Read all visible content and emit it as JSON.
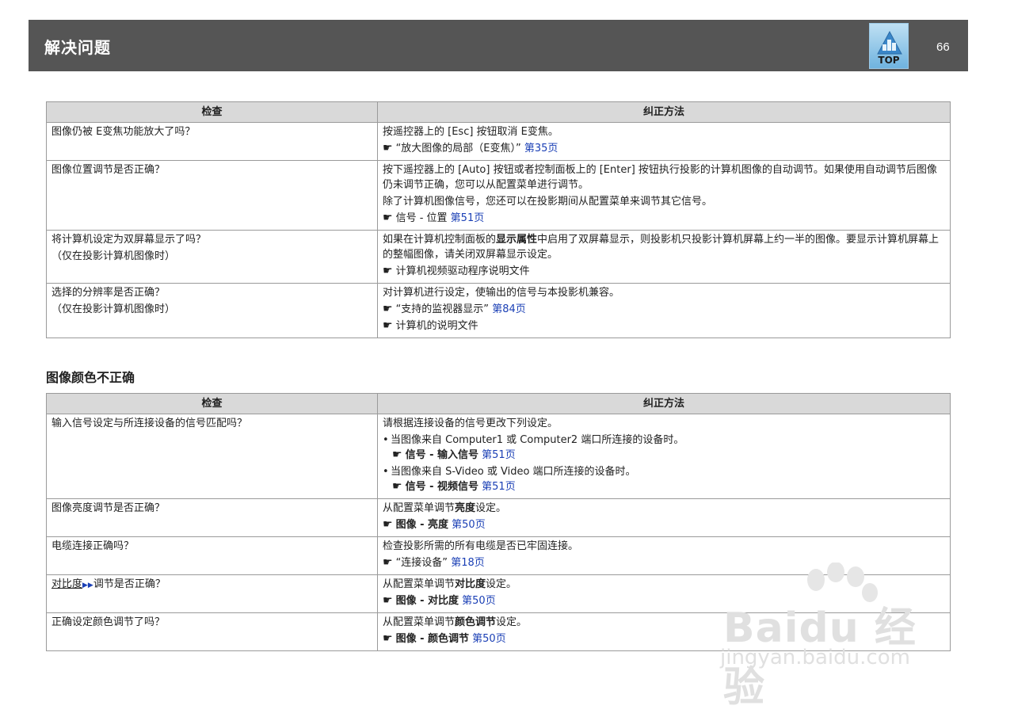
{
  "header": {
    "title": "解决问题",
    "top_label": "TOP",
    "page_number": "66"
  },
  "table1": {
    "col_check": "检查",
    "col_fix": "纠正方法",
    "rows": [
      {
        "check": [
          "图像仍被 E变焦功能放大了吗？"
        ],
        "fix": {
          "l1": "按遥控器上的 [Esc] 按钮取消 E变焦。",
          "ref_text": "“放大图像的局部（E变焦）”",
          "ref_page": "第35页"
        }
      },
      {
        "check": [
          "图像位置调节是否正确？"
        ],
        "fix": {
          "l1": "按下遥控器上的 [Auto] 按钮或者控制面板上的 [Enter] 按钮执行投影的计算机图像的自动调节。如果使用自动调节后图像仍未调节正确，您可以从配置菜单进行调节。",
          "l2": "除了计算机图像信号，您还可以在投影期间从配置菜单来调节其它信号。",
          "ref_text": "信号 - 位置",
          "ref_page": "第51页"
        }
      },
      {
        "check": [
          "将计算机设定为双屏幕显示了吗？",
          "（仅在投影计算机图像时）"
        ],
        "fix": {
          "l1a": "如果在计算机控制面板的",
          "l1b": "显示属性",
          "l1c": "中启用了双屏幕显示，则投影机只投影计算机屏幕上约一半的图像。要显示计算机屏幕上的整幅图像，请关闭双屏幕显示设定。",
          "ref_text": "计算机视频驱动程序说明文件"
        }
      },
      {
        "check": [
          "选择的分辨率是否正确？",
          "（仅在投影计算机图像时）"
        ],
        "fix": {
          "l1": "对计算机进行设定，使输出的信号与本投影机兼容。",
          "ref_text": "“支持的监视器显示”",
          "ref_page": "第84页",
          "ref2_text": "计算机的说明文件"
        }
      }
    ]
  },
  "section2": {
    "title": "图像颜色不正确"
  },
  "table2": {
    "col_check": "检查",
    "col_fix": "纠正方法",
    "rows": [
      {
        "check": "输入信号设定与所连接设备的信号匹配吗？",
        "fix": {
          "l1": "请根据连接设备的信号更改下列设定。",
          "b1": "当图像来自 Computer1 或 Computer2 端口所连接的设备时。",
          "b1_ref": "信号 - 输入信号",
          "b1_page": "第51页",
          "b2": "当图像来自 S-Video 或 Video 端口所连接的设备时。",
          "b2_ref": "信号 - 视频信号",
          "b2_page": "第51页"
        }
      },
      {
        "check": "图像亮度调节是否正确？",
        "fix": {
          "l1a": "从配置菜单调节",
          "l1b": "亮度",
          "l1c": "设定。",
          "ref_text": "图像 - 亮度",
          "ref_page": "第50页"
        }
      },
      {
        "check": "电缆连接正确吗？",
        "fix": {
          "l1": "检查投影所需的所有电缆是否已牢固连接。",
          "ref_text": "“连接设备”",
          "ref_page": "第18页"
        }
      },
      {
        "check_link": "对比度",
        "check_rest": "调节是否正确？",
        "fix": {
          "l1a": "从配置菜单调节",
          "l1b": "对比度",
          "l1c": "设定。",
          "ref_text": "图像 - 对比度",
          "ref_page": "第50页"
        }
      },
      {
        "check": "正确设定颜色调节了吗？",
        "fix": {
          "l1a": "从配置菜单调节",
          "l1b": "颜色调节",
          "l1c": "设定。",
          "ref_text": "图像 - 颜色调节",
          "ref_page": "第50页"
        }
      }
    ]
  },
  "watermark": {
    "big": "Baidu 经验",
    "small": "jingyan.baidu.com"
  }
}
